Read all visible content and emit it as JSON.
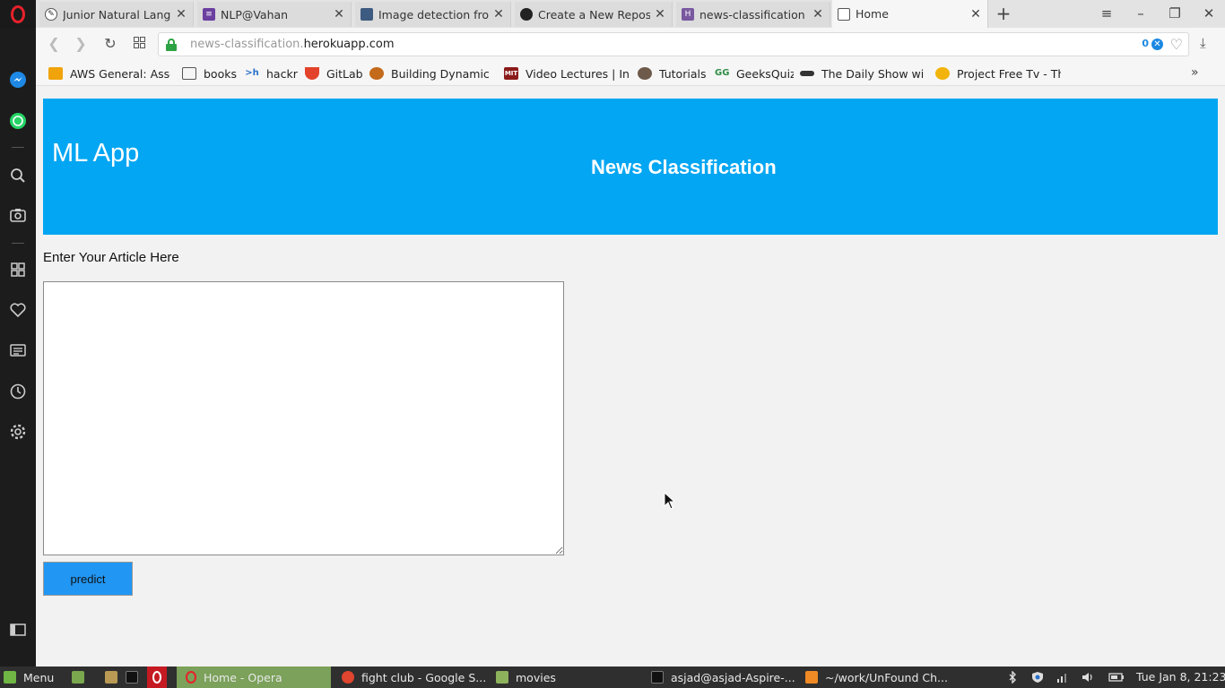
{
  "browser": {
    "tabs": [
      {
        "title": "Junior Natural Languag",
        "active": false
      },
      {
        "title": "NLP@Vahan",
        "active": false
      },
      {
        "title": "Image detection from",
        "active": false
      },
      {
        "title": "Create a New Reposito",
        "active": false
      },
      {
        "title": "news-classification | H",
        "active": false
      },
      {
        "title": "Home",
        "active": true
      }
    ],
    "new_tab": "+",
    "url": {
      "subdomain": "news-classification.",
      "domain": "herokuapp.com"
    },
    "adblock_count": "0",
    "bookmarks": [
      {
        "label": "AWS General: Assoc",
        "icon": "aws-box-icon"
      },
      {
        "label": "books",
        "icon": "folder-icon"
      },
      {
        "label": "hackr",
        "icon": "hackr-icon"
      },
      {
        "label": "GitLab",
        "icon": "gitlab-icon"
      },
      {
        "label": "Building Dynamic W",
        "icon": "site-icon"
      },
      {
        "label": "Video Lectures | Int",
        "icon": "mit-ocw-icon"
      },
      {
        "label": "Tutorials",
        "icon": "person-icon"
      },
      {
        "label": "GeeksQuiz",
        "icon": "geeks-icon"
      },
      {
        "label": "The Daily Show with",
        "icon": "comedy-central-icon"
      },
      {
        "label": "Project Free Tv - The",
        "icon": "pftv-icon"
      }
    ],
    "bookmarks_more": "»"
  },
  "page": {
    "app_name": "ML App",
    "header_title": "News Classification",
    "article_label": "Enter Your Article Here",
    "article_value": "",
    "predict_label": "predict"
  },
  "taskbar": {
    "menu_label": "Menu",
    "windows": [
      {
        "label": "Home - Opera",
        "active": true
      },
      {
        "label": "fight club - Google S...",
        "active": false
      },
      {
        "label": "movies",
        "active": false
      },
      {
        "label": "asjad@asjad-Aspire-...",
        "active": false
      },
      {
        "label": "~/work/UnFound Ch...",
        "active": false
      }
    ],
    "clock": "Tue Jan  8, 21:23"
  },
  "colors": {
    "header_bg": "#03a6f2",
    "button_bg": "#2196f3",
    "taskbar_active": "#7ba15a",
    "opera_red": "#e8212a"
  }
}
